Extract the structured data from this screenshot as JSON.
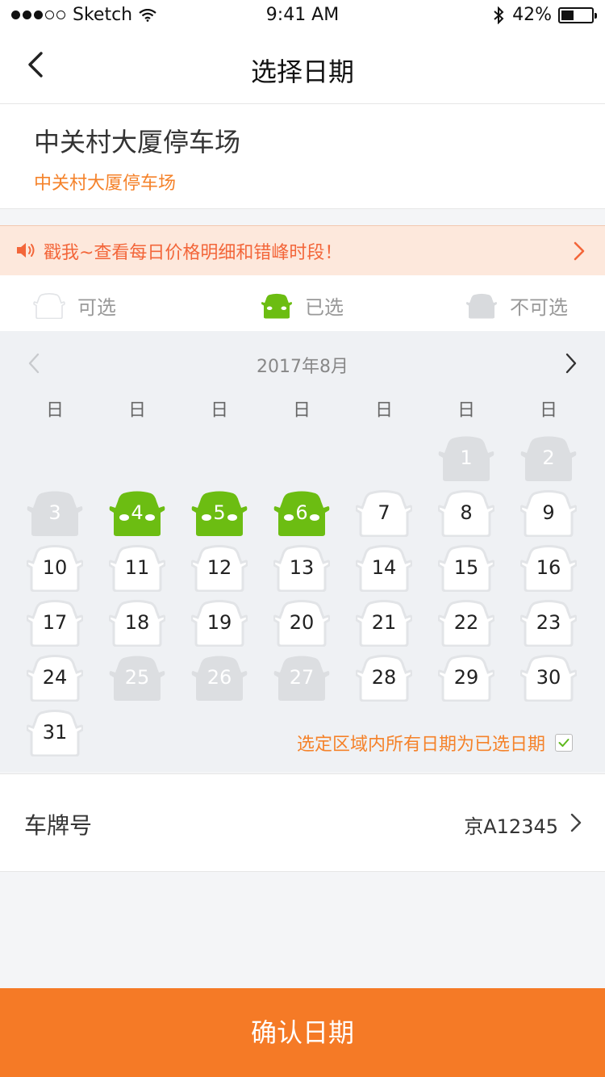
{
  "status_bar": {
    "carrier": "Sketch",
    "time": "9:41 AM",
    "battery": "42%",
    "battery_level": 0.42
  },
  "nav": {
    "title": "选择日期",
    "back_icon": "chevron-left-icon"
  },
  "lot": {
    "name": "中关村大厦停车场",
    "subtitle": "中关村大厦停车场"
  },
  "promo": {
    "text": "戳我~查看每日价格明细和错峰时段！",
    "icon": "speaker-icon"
  },
  "legend": {
    "available": "可选",
    "selected": "已选",
    "unavailable": "不可选"
  },
  "calendar": {
    "month_label": "2017年8月",
    "weekdays": [
      "日",
      "日",
      "日",
      "日",
      "日",
      "日",
      "日"
    ],
    "first_weekday_index": 5,
    "days": [
      {
        "day": "1",
        "state": "unavailable"
      },
      {
        "day": "2",
        "state": "unavailable"
      },
      {
        "day": "3",
        "state": "unavailable"
      },
      {
        "day": "4",
        "state": "selected"
      },
      {
        "day": "5",
        "state": "selected"
      },
      {
        "day": "6",
        "state": "selected"
      },
      {
        "day": "7",
        "state": "available"
      },
      {
        "day": "8",
        "state": "available"
      },
      {
        "day": "9",
        "state": "available"
      },
      {
        "day": "10",
        "state": "available"
      },
      {
        "day": "11",
        "state": "available"
      },
      {
        "day": "12",
        "state": "available"
      },
      {
        "day": "13",
        "state": "available"
      },
      {
        "day": "14",
        "state": "available"
      },
      {
        "day": "15",
        "state": "available"
      },
      {
        "day": "16",
        "state": "available"
      },
      {
        "day": "17",
        "state": "available"
      },
      {
        "day": "18",
        "state": "available"
      },
      {
        "day": "19",
        "state": "available"
      },
      {
        "day": "20",
        "state": "available"
      },
      {
        "day": "21",
        "state": "available"
      },
      {
        "day": "22",
        "state": "available"
      },
      {
        "day": "23",
        "state": "available"
      },
      {
        "day": "24",
        "state": "available"
      },
      {
        "day": "25",
        "state": "unavailable"
      },
      {
        "day": "26",
        "state": "unavailable"
      },
      {
        "day": "27",
        "state": "unavailable"
      },
      {
        "day": "28",
        "state": "available"
      },
      {
        "day": "29",
        "state": "available"
      },
      {
        "day": "30",
        "state": "available"
      },
      {
        "day": "31",
        "state": "available"
      }
    ],
    "select_all_label": "选定区域内所有日期为已选日期",
    "select_all_checked": true
  },
  "plate": {
    "label": "车牌号",
    "value": "京A12345"
  },
  "confirm": {
    "label": "确认日期"
  },
  "colors": {
    "accent": "#f57a26",
    "selected": "#6cbd12",
    "unavailable": "#dcdee1",
    "promo_text": "#f3663a",
    "promo_bg": "#fde8dc"
  }
}
